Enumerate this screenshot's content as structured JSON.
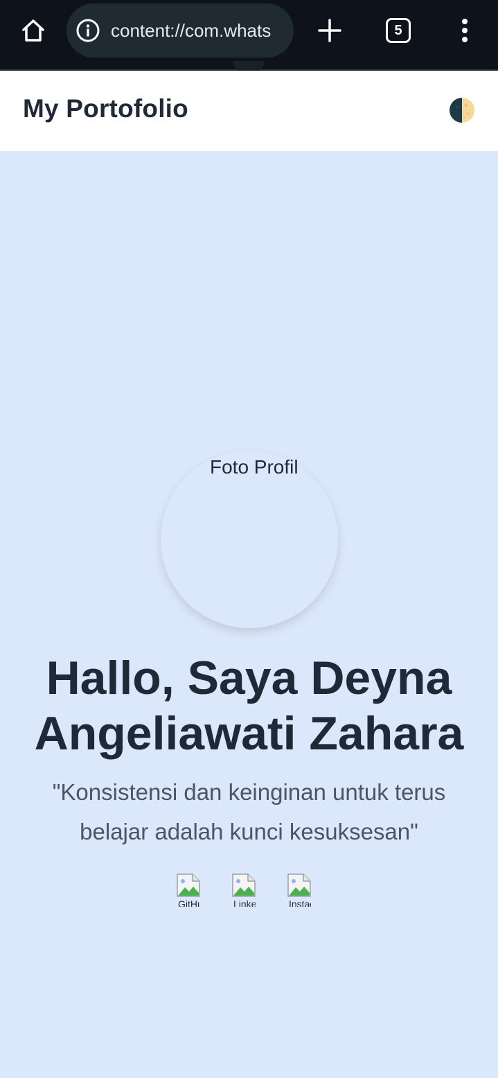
{
  "browser": {
    "url": "content://com.whats",
    "tab_count": "5",
    "icons": {
      "home": "home-icon",
      "info": "info-icon",
      "new_tab": "plus-icon",
      "menu": "vertical-dots-icon"
    }
  },
  "header": {
    "title": "My Portofolio",
    "theme_toggle_icon": "moon-phase-icon"
  },
  "hero": {
    "profile_alt": "Foto Profil",
    "name_line1": "Hallo, Saya Deyna",
    "name_line2": "Angeliawati Zahara",
    "quote_line1": "\"Konsistensi dan keinginan untuk terus",
    "quote_line2": "belajar adalah kunci kesuksesan\"",
    "social_links": [
      {
        "alt": "GitHub",
        "icon": "broken-image-icon"
      },
      {
        "alt": "LinkedIn",
        "icon": "broken-image-icon"
      },
      {
        "alt": "Instagram",
        "icon": "broken-image-icon"
      }
    ]
  },
  "colors": {
    "browser_bar": "#0e131b",
    "url_pill": "#1f2a33",
    "page_background": "#dbe8fb",
    "heading_text": "#1f2937",
    "quote_text": "#4b5563"
  }
}
